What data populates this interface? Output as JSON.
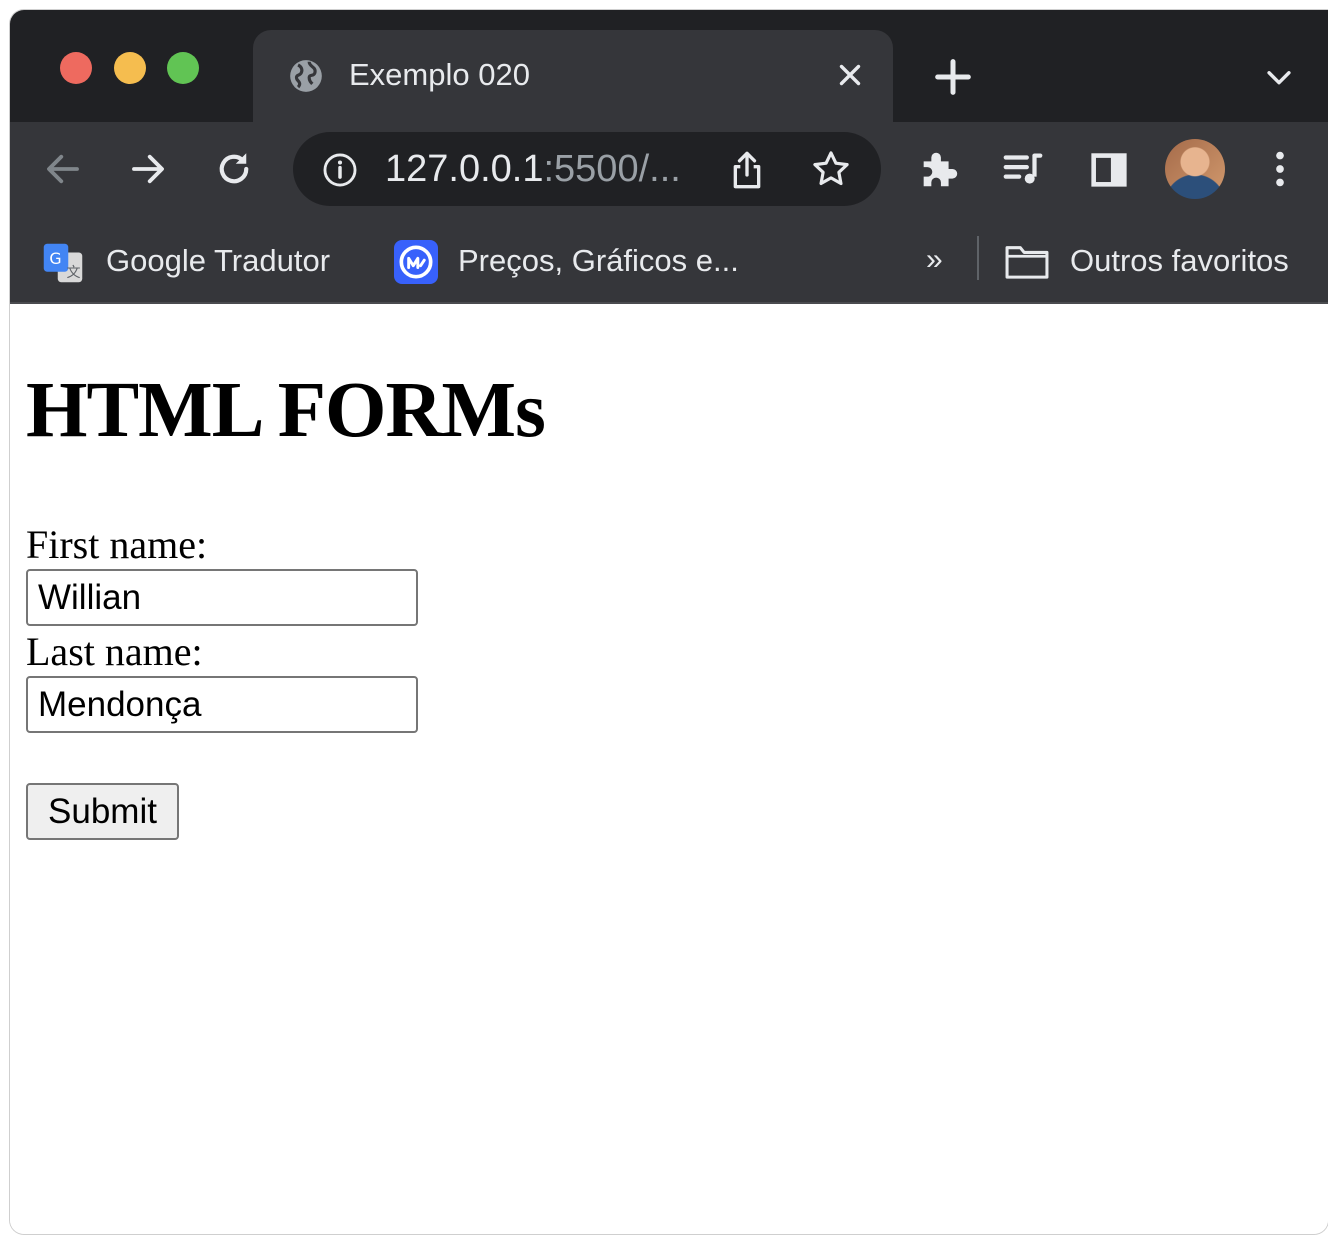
{
  "browser": {
    "tab": {
      "title": "Exemplo 020",
      "icon": "globe-icon"
    },
    "omnibox": {
      "url_host": "127.0.0.1",
      "url_rest": ":5500/..."
    },
    "bookmarks": [
      {
        "label": "Google Tradutor",
        "icon": "google-translate-icon"
      },
      {
        "label": "Preços, Gráficos e...",
        "icon": "coinmarketcap-icon"
      }
    ],
    "bookmarks_overflow": "»",
    "other_bookmarks": {
      "label": "Outros favoritos",
      "icon": "folder-icon"
    }
  },
  "page": {
    "heading": "HTML FORMs",
    "form": {
      "first_name_label": "First name:",
      "first_name_value": "Willian",
      "last_name_label": "Last name:",
      "last_name_value": "Mendonça",
      "submit_label": "Submit"
    }
  },
  "colors": {
    "tabstrip": "#202124",
    "toolbar": "#35363a",
    "accent_blue": "#3861fb"
  }
}
